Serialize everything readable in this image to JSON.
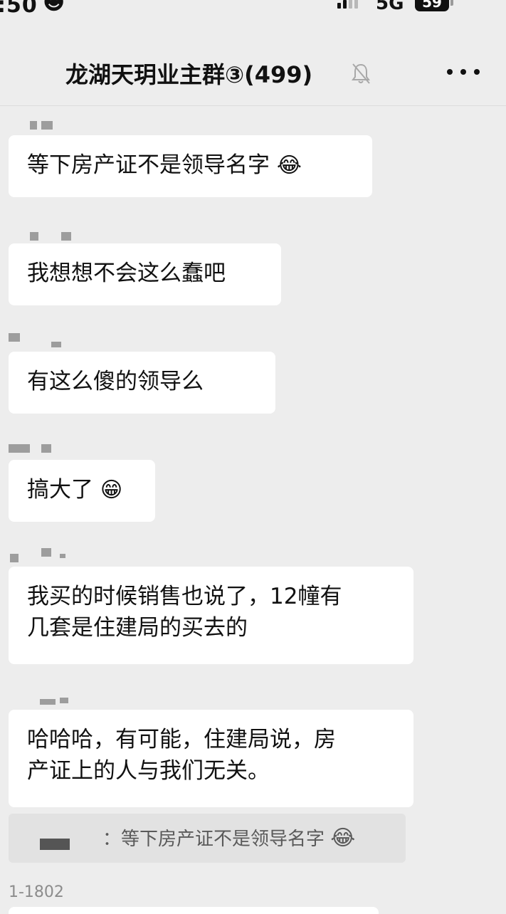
{
  "status_bar": {
    "time": ":50",
    "network": "5G",
    "battery": "59"
  },
  "header": {
    "title": "龙湖天玥业主群③(499)"
  },
  "messages": [
    {
      "text": "等下房产证不是领导名字",
      "emoji": "😂"
    },
    {
      "text": "我想想不会这么蠢吧"
    },
    {
      "text": "有这么傻的领导么"
    },
    {
      "text": "搞大了",
      "emoji": "😁"
    },
    {
      "lines": [
        "我买的时候销售也说了，12幢有",
        "几套是住建局的买去的"
      ]
    },
    {
      "lines": [
        "哈哈哈，有可能，住建局说，房",
        "产证上的人与我们无关。"
      ]
    }
  ],
  "quote": {
    "text": "：等下房产证不是领导名字",
    "emoji": "😂"
  },
  "next_sender": "1-1802"
}
